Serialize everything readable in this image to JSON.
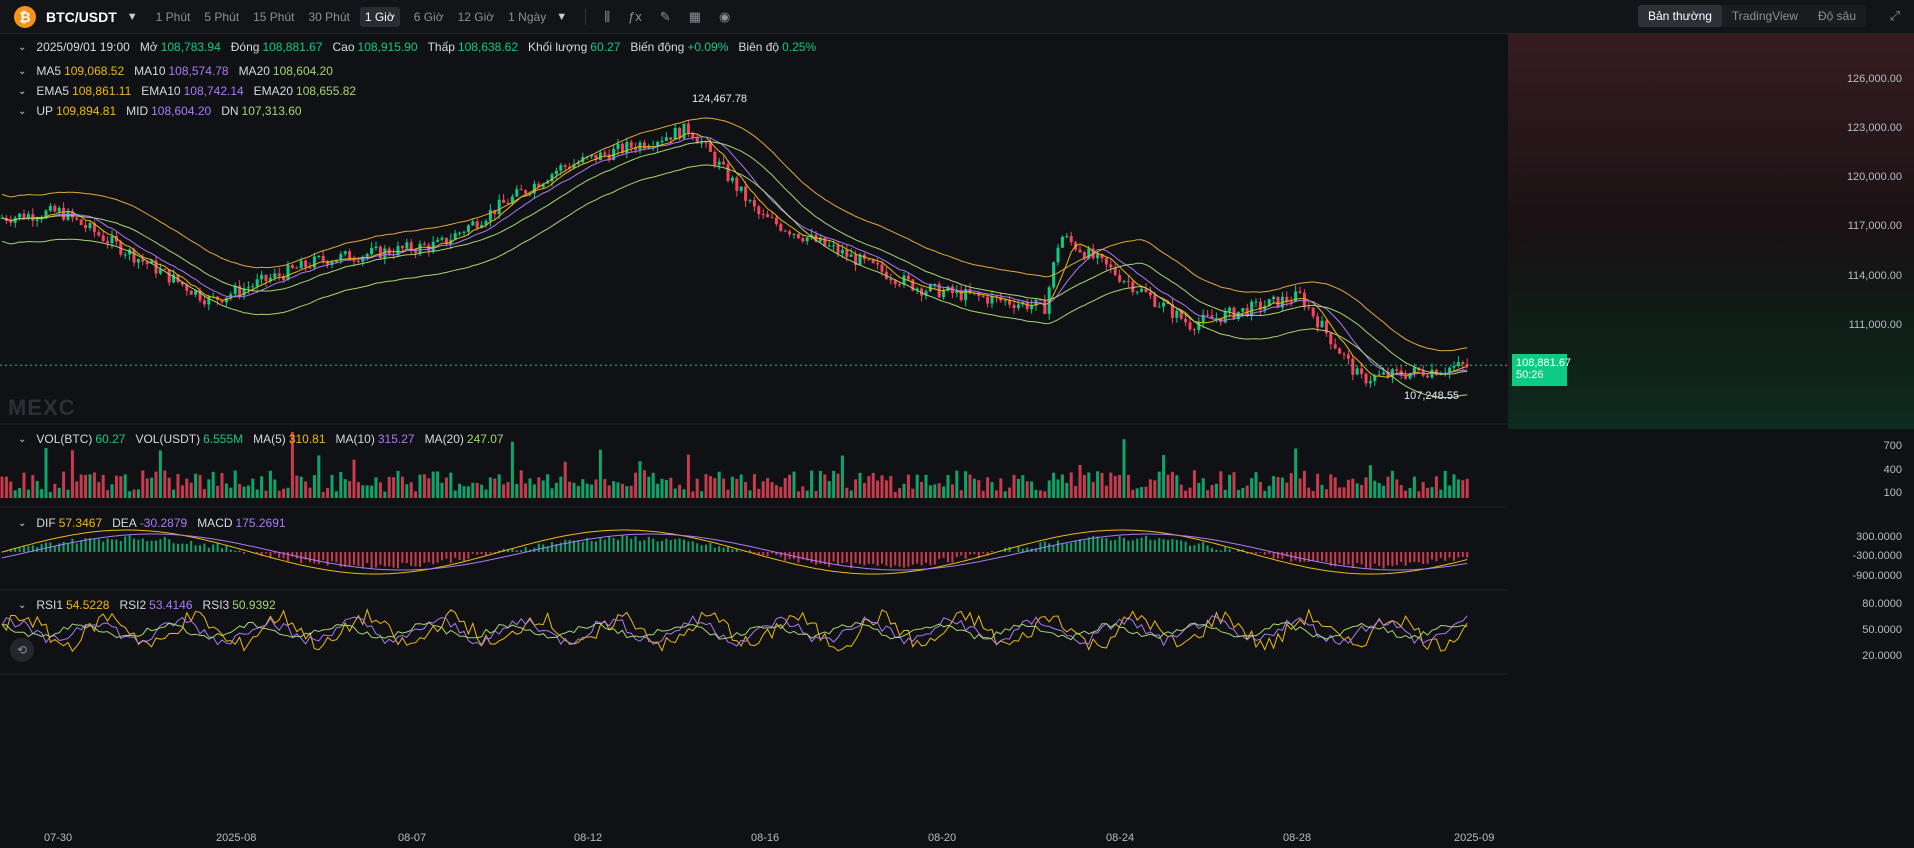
{
  "header": {
    "coin_icon": "bitcoin-icon",
    "pair": "BTC/USDT",
    "timeframes": [
      "1 Phút",
      "5 Phút",
      "15 Phút",
      "30 Phút",
      "1 Giờ",
      "6 Giờ",
      "12 Giờ",
      "1 Ngày"
    ],
    "active_timeframe": "1 Giờ",
    "tool_icons": [
      "candle-type-icon",
      "indicator-icon",
      "draw-icon",
      "layout-grid-icon",
      "camera-icon"
    ],
    "views": [
      "Bản thường",
      "TradingView",
      "Độ sâu"
    ],
    "active_view": "Bản thường"
  },
  "ohlc": {
    "date": "2025/09/01 19:00",
    "open_label": "Mở",
    "open": "108,783.94",
    "close_label": "Đóng",
    "close": "108,881.67",
    "high_label": "Cao",
    "high": "108,915.90",
    "low_label": "Thấp",
    "low": "108,638.62",
    "vol_label": "Khối lượng",
    "vol": "60.27",
    "change_label": "Biến động",
    "change": "+0.09%",
    "amp_label": "Biên độ",
    "amp": "0.25%"
  },
  "ma": {
    "ma5_label": "MA5",
    "ma5": "109,068.52",
    "ma10_label": "MA10",
    "ma10": "108,574.78",
    "ma20_label": "MA20",
    "ma20": "108,604.20"
  },
  "ema": {
    "ema5_label": "EMA5",
    "ema5": "108,861.11",
    "ema10_label": "EMA10",
    "ema10": "108,742.14",
    "ema20_label": "EMA20",
    "ema20": "108,655.82"
  },
  "boll": {
    "up_label": "UP",
    "up": "109,894.81",
    "mid_label": "MID",
    "mid": "108,604.20",
    "dn_label": "DN",
    "dn": "107,313.60"
  },
  "vol": {
    "btc_label": "VOL(BTC)",
    "btc": "60.27",
    "usdt_label": "VOL(USDT)",
    "usdt": "6.555M",
    "ma5_label": "MA(5)",
    "ma5": "310.81",
    "ma10_label": "MA(10)",
    "ma10": "315.27",
    "ma20_label": "MA(20)",
    "ma20": "247.07"
  },
  "macd": {
    "dif_label": "DIF",
    "dif": "57.3467",
    "dea_label": "DEA",
    "dea": "-30.2879",
    "macd_label": "MACD",
    "macd": "175.2691"
  },
  "rsi": {
    "rsi1_label": "RSI1",
    "rsi1": "54.5228",
    "rsi2_label": "RSI2",
    "rsi2": "53.4146",
    "rsi3_label": "RSI3",
    "rsi3": "50.9392"
  },
  "price_axis": [
    "126,000.00",
    "123,000.00",
    "120,000.00",
    "117,000.00",
    "114,000.00",
    "111,000.00"
  ],
  "last_price": "108,881.67",
  "countdown": "50:26",
  "max_marker": "124,467.78",
  "min_marker": "107,248.55",
  "vol_axis": [
    "700",
    "400",
    "100"
  ],
  "macd_axis": [
    "300.0000",
    "-300.0000",
    "-900.0000"
  ],
  "rsi_axis": [
    "80.0000",
    "50.0000",
    "20.0000"
  ],
  "time_axis": [
    "07-30",
    "2025-08",
    "08-07",
    "08-12",
    "08-16",
    "08-20",
    "08-24",
    "08-28",
    "2025-09"
  ],
  "watermark": "MEXC",
  "colors": {
    "up": "#0ecb81",
    "down": "#f6465d",
    "ma5": "#f0b90b",
    "ma10": "#a97bf5",
    "ma20": "#a8d66e"
  },
  "chart_data": {
    "type": "line",
    "title": "",
    "xlabel": "",
    "ylabel": "",
    "x": [
      "07-30",
      "2025-08",
      "08-07",
      "08-12",
      "08-16",
      "08-20",
      "08-24",
      "08-28",
      "2025-09"
    ],
    "series": [
      {
        "values": [
          118300,
          113000,
          115600,
          120200,
          117600,
          114200,
          115300,
          111700,
          108880
        ]
      }
    ],
    "ylim": [
      105000,
      127500
    ],
    "grid": false
  }
}
